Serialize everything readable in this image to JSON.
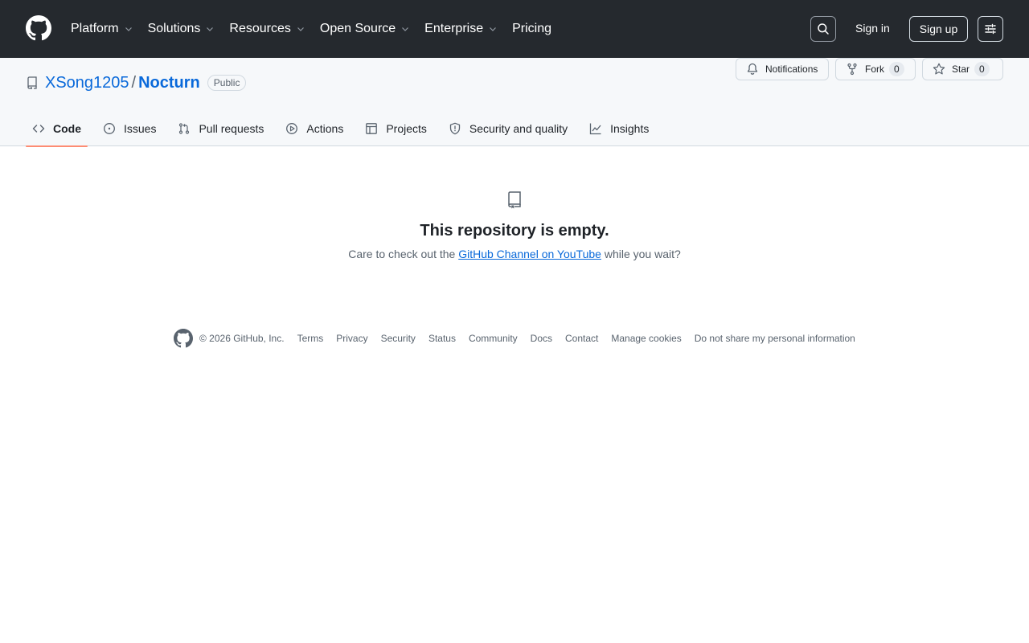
{
  "header": {
    "logo_icon": "github-mark-icon",
    "nav": [
      {
        "label": "Platform"
      },
      {
        "label": "Solutions"
      },
      {
        "label": "Resources"
      },
      {
        "label": "Open Source"
      },
      {
        "label": "Enterprise"
      },
      {
        "label": "Pricing"
      }
    ],
    "search_icon": "search-icon",
    "sign_in": "Sign in",
    "sign_up": "Sign up",
    "menu_icon": "sliders-icon"
  },
  "repo": {
    "owner": "XSong1205",
    "separator": "/",
    "name": "Nocturn",
    "visibility": "Public",
    "notifications_label": "Notifications",
    "fork_label": "Fork",
    "fork_count": "0",
    "star_label": "Star",
    "star_count": "0"
  },
  "tabs": [
    {
      "label": "Code",
      "icon": "code-icon",
      "selected": true
    },
    {
      "label": "Issues",
      "icon": "issue-icon"
    },
    {
      "label": "Pull requests",
      "icon": "pull-request-icon"
    },
    {
      "label": "Actions",
      "icon": "play-icon"
    },
    {
      "label": "Projects",
      "icon": "table-icon"
    },
    {
      "label": "Security and quality",
      "icon": "shield-icon"
    },
    {
      "label": "Insights",
      "icon": "graph-icon"
    }
  ],
  "empty": {
    "title": "This repository is empty.",
    "desc_before": "Care to check out the ",
    "link": "GitHub Channel on YouTube",
    "desc_after": " while you wait?"
  },
  "footer": {
    "copyright": "© 2026 GitHub, Inc.",
    "links": [
      "Terms",
      "Privacy",
      "Security",
      "Status",
      "Community",
      "Docs",
      "Contact",
      "Manage cookies",
      "Do not share my personal information"
    ]
  },
  "colors": {
    "header_bg": "#25292e",
    "link": "#0969da",
    "tab_underline": "#fd8c73",
    "muted": "#59636e"
  }
}
